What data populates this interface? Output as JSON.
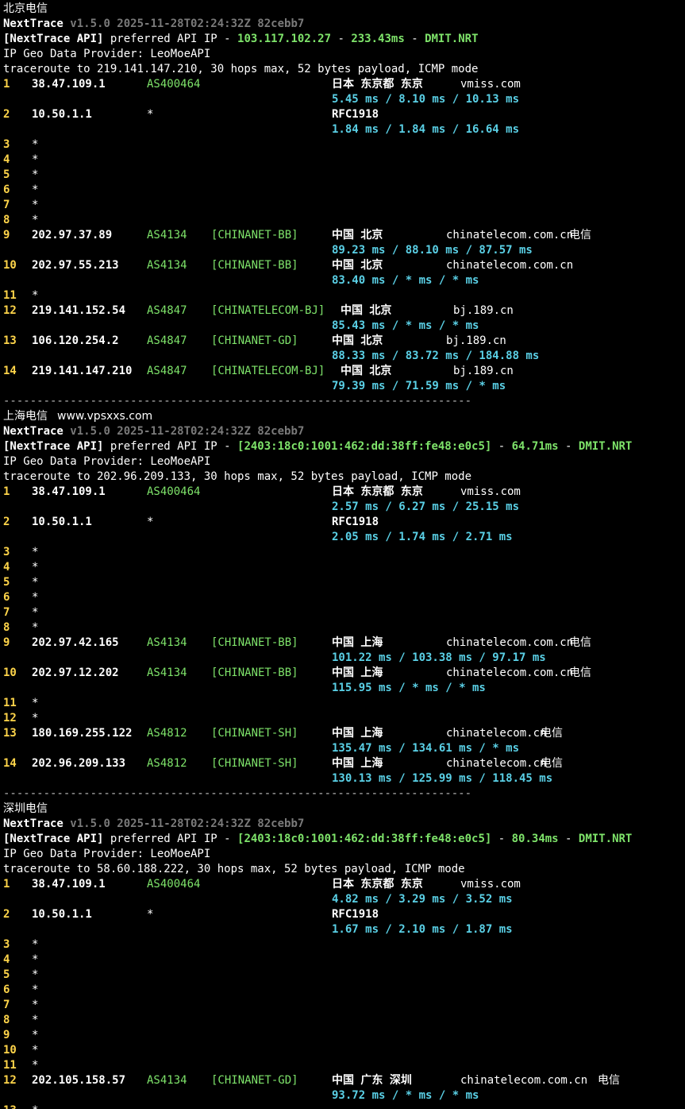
{
  "sections": [
    {
      "title": "北京电信",
      "app": "NextTrace",
      "version": "v1.5.0 2025-11-28T02:24:32Z 82cebb7",
      "api_tag": "[NextTrace API]",
      "api_text": " preferred API IP - ",
      "api_ip": "103.117.102.27",
      "api_dash1": " - ",
      "api_latency": "233.43ms",
      "api_dash2": " - ",
      "api_node": "DMIT.NRT",
      "geo_provider": "IP Geo Data Provider: LeoMoeAPI",
      "traceroute": "traceroute to 219.141.147.210, 30 hops max, 52 bytes payload, ICMP mode",
      "hops": [
        {
          "n": "1",
          "ip": "38.47.109.1",
          "asn": "AS400464",
          "tag": "",
          "geo": "日本 东京都 东京",
          "host": "vmiss.com",
          "isp": "",
          "rtt": "5.45 ms / 8.10 ms / 10.13 ms"
        },
        {
          "n": "2",
          "ip": "10.50.1.1",
          "asn": "*",
          "tag": "",
          "geo": "RFC1918",
          "host": "",
          "isp": "",
          "rtt": "1.84 ms / 1.84 ms / 16.64 ms"
        },
        {
          "n": "3",
          "ip": "*"
        },
        {
          "n": "4",
          "ip": "*"
        },
        {
          "n": "5",
          "ip": "*"
        },
        {
          "n": "6",
          "ip": "*"
        },
        {
          "n": "7",
          "ip": "*"
        },
        {
          "n": "8",
          "ip": "*"
        },
        {
          "n": "9",
          "ip": "202.97.37.89",
          "asn": "AS4134",
          "tag": "[CHINANET-BB]",
          "geo": "中国 北京",
          "host": "chinatelecom.com.cn",
          "isp": "电信",
          "rtt": "89.23 ms / 88.10 ms / 87.57 ms"
        },
        {
          "n": "10",
          "ip": "202.97.55.213",
          "asn": "AS4134",
          "tag": "[CHINANET-BB]",
          "geo": "中国 北京",
          "host": "chinatelecom.com.cn",
          "isp": "",
          "rtt": "83.40 ms / * ms / * ms"
        },
        {
          "n": "11",
          "ip": "*"
        },
        {
          "n": "12",
          "ip": "219.141.152.54",
          "asn": "AS4847",
          "tag": "[CHINATELECOM-BJ]",
          "geo": "中国 北京",
          "host": "bj.189.cn",
          "isp": "",
          "rtt": "85.43 ms / * ms / * ms",
          "shift": true
        },
        {
          "n": "13",
          "ip": "106.120.254.2",
          "asn": "AS4847",
          "tag": "[CHINANET-GD]",
          "geo": "中国 北京",
          "host": "bj.189.cn",
          "isp": "",
          "rtt": "88.33 ms / 83.72 ms / 184.88 ms"
        },
        {
          "n": "14",
          "ip": "219.141.147.210",
          "asn": "AS4847",
          "tag": "[CHINATELECOM-BJ]",
          "geo": "中国 北京",
          "host": "bj.189.cn",
          "isp": "",
          "rtt": "79.39 ms / 71.59 ms / * ms",
          "shift": true
        }
      ],
      "separator": "----------------------------------------------------------------------"
    },
    {
      "title": "上海电信",
      "site": "www.vpsxxs.com",
      "app": "NextTrace",
      "version": "v1.5.0 2025-11-28T02:24:32Z 82cebb7",
      "api_tag": "[NextTrace API]",
      "api_text": " preferred API IP - ",
      "api_ip": "[2403:18c0:1001:462:dd:38ff:fe48:e0c5]",
      "api_dash1": " - ",
      "api_latency": "64.71ms",
      "api_dash2": " - ",
      "api_node": "DMIT.NRT",
      "geo_provider": "IP Geo Data Provider: LeoMoeAPI",
      "traceroute": "traceroute to 202.96.209.133, 30 hops max, 52 bytes payload, ICMP mode",
      "hops": [
        {
          "n": "1",
          "ip": "38.47.109.1",
          "asn": "AS400464",
          "tag": "",
          "geo": "日本 东京都 东京",
          "host": "vmiss.com",
          "isp": "",
          "rtt": "2.57 ms / 6.27 ms / 25.15 ms"
        },
        {
          "n": "2",
          "ip": "10.50.1.1",
          "asn": "*",
          "tag": "",
          "geo": "RFC1918",
          "host": "",
          "isp": "",
          "rtt": "2.05 ms / 1.74 ms / 2.71 ms"
        },
        {
          "n": "3",
          "ip": "*"
        },
        {
          "n": "4",
          "ip": "*"
        },
        {
          "n": "5",
          "ip": "*"
        },
        {
          "n": "6",
          "ip": "*"
        },
        {
          "n": "7",
          "ip": "*"
        },
        {
          "n": "8",
          "ip": "*"
        },
        {
          "n": "9",
          "ip": "202.97.42.165",
          "asn": "AS4134",
          "tag": "[CHINANET-BB]",
          "geo": "中国 上海",
          "host": "chinatelecom.com.cn",
          "isp": "电信",
          "rtt": "101.22 ms / 103.38 ms / 97.17 ms"
        },
        {
          "n": "10",
          "ip": "202.97.12.202",
          "asn": "AS4134",
          "tag": "[CHINANET-BB]",
          "geo": "中国 上海",
          "host": "chinatelecom.com.cn",
          "isp": "电信",
          "rtt": "115.95 ms / * ms / * ms"
        },
        {
          "n": "11",
          "ip": "*"
        },
        {
          "n": "12",
          "ip": "*"
        },
        {
          "n": "13",
          "ip": "180.169.255.122",
          "asn": "AS4812",
          "tag": "[CHINANET-SH]",
          "geo": "中国 上海",
          "host": "chinatelecom.cn",
          "isp": "电信",
          "rtt": "135.47 ms / 134.61 ms / * ms"
        },
        {
          "n": "14",
          "ip": "202.96.209.133",
          "asn": "AS4812",
          "tag": "[CHINANET-SH]",
          "geo": "中国 上海",
          "host": "chinatelecom.cn",
          "isp": "电信",
          "rtt": "130.13 ms / 125.99 ms / 118.45 ms"
        }
      ],
      "separator": "----------------------------------------------------------------------"
    },
    {
      "title": "深圳电信",
      "app": "NextTrace",
      "version": "v1.5.0 2025-11-28T02:24:32Z 82cebb7",
      "api_tag": "[NextTrace API]",
      "api_text": " preferred API IP - ",
      "api_ip": "[2403:18c0:1001:462:dd:38ff:fe48:e0c5]",
      "api_dash1": " - ",
      "api_latency": "80.34ms",
      "api_dash2": " - ",
      "api_node": "DMIT.NRT",
      "geo_provider": "IP Geo Data Provider: LeoMoeAPI",
      "traceroute": "traceroute to 58.60.188.222, 30 hops max, 52 bytes payload, ICMP mode",
      "hops": [
        {
          "n": "1",
          "ip": "38.47.109.1",
          "asn": "AS400464",
          "tag": "",
          "geo": "日本 东京都 东京",
          "host": "vmiss.com",
          "isp": "",
          "rtt": "4.82 ms / 3.29 ms / 3.52 ms"
        },
        {
          "n": "2",
          "ip": "10.50.1.1",
          "asn": "*",
          "tag": "",
          "geo": "RFC1918",
          "host": "",
          "isp": "",
          "rtt": "1.67 ms / 2.10 ms / 1.87 ms"
        },
        {
          "n": "3",
          "ip": "*"
        },
        {
          "n": "4",
          "ip": "*"
        },
        {
          "n": "5",
          "ip": "*"
        },
        {
          "n": "6",
          "ip": "*"
        },
        {
          "n": "7",
          "ip": "*"
        },
        {
          "n": "8",
          "ip": "*"
        },
        {
          "n": "9",
          "ip": "*"
        },
        {
          "n": "10",
          "ip": "*"
        },
        {
          "n": "11",
          "ip": "*"
        },
        {
          "n": "12",
          "ip": "202.105.158.57",
          "asn": "AS4134",
          "tag": "[CHINANET-GD]",
          "geo": "中国 广东 深圳",
          "host": "chinatelecom.com.cn",
          "isp": "电信",
          "rtt": "93.72 ms / * ms / * ms"
        },
        {
          "n": "13",
          "ip": "*"
        }
      ]
    }
  ]
}
